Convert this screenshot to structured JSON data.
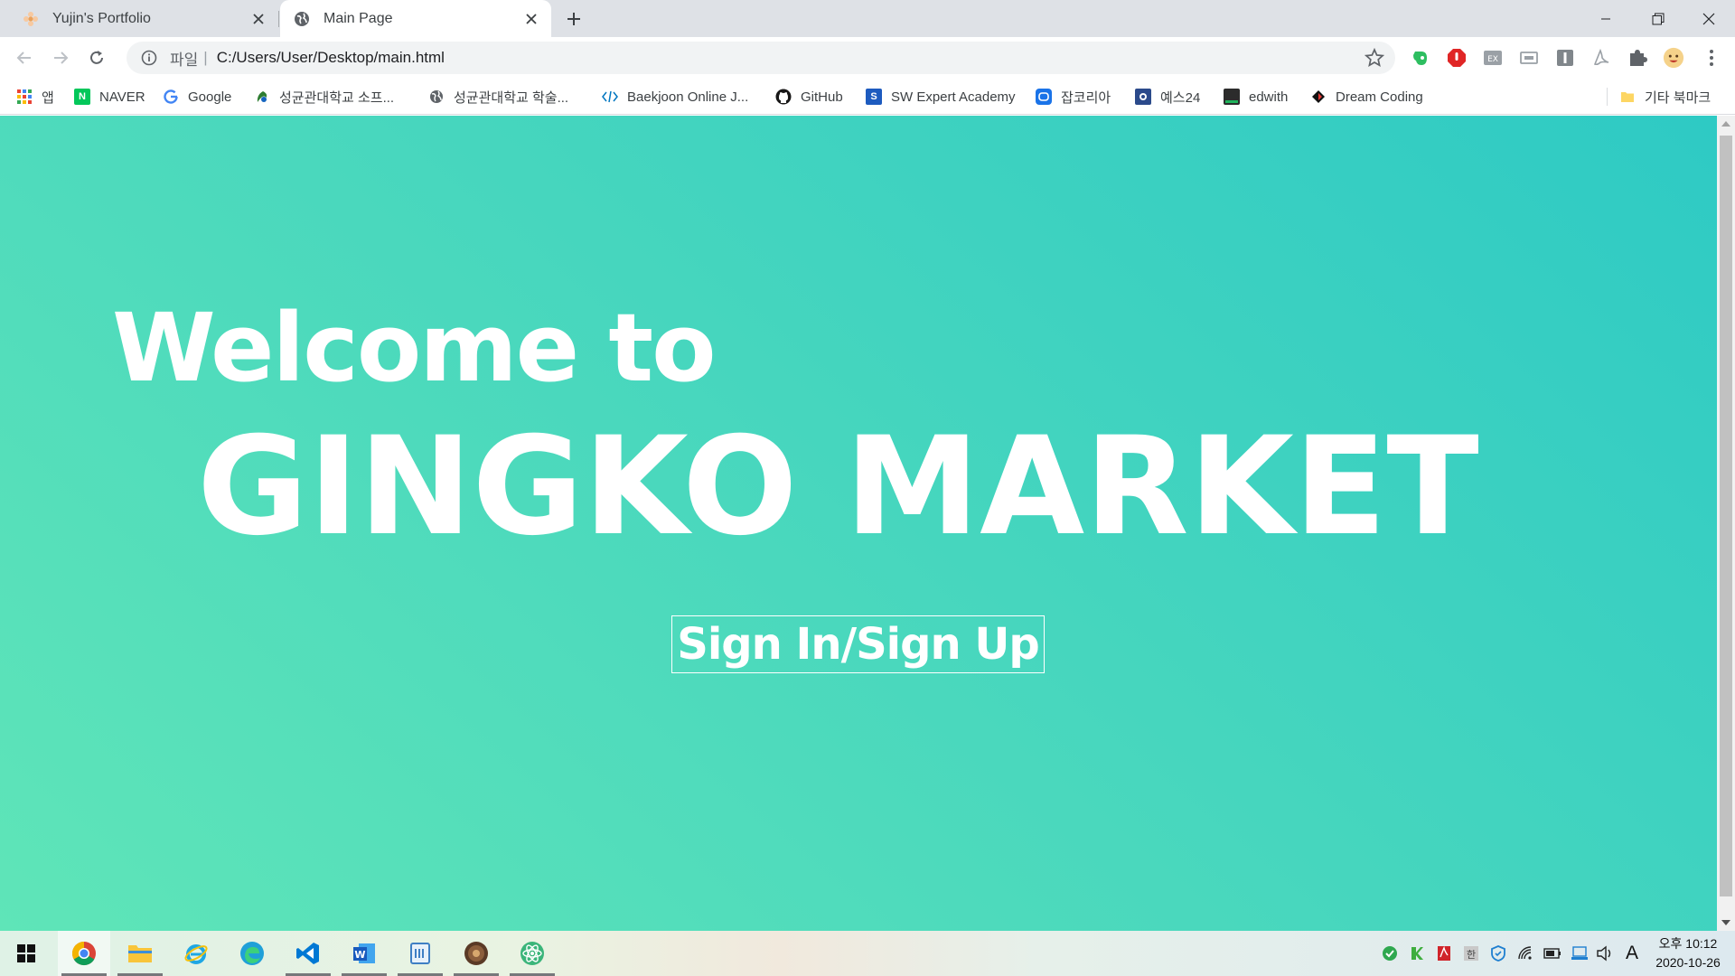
{
  "browser": {
    "tabs": [
      {
        "title": "Yujin's Portfolio",
        "active": false
      },
      {
        "title": "Main Page",
        "active": true
      }
    ],
    "address": {
      "scheme_label": "파일",
      "url": "C:/Users/User/Desktop/main.html"
    }
  },
  "bookmarks": {
    "apps_label": "앱",
    "items": [
      {
        "label": "NAVER",
        "icon": "naver-icon"
      },
      {
        "label": "Google",
        "icon": "google-icon"
      },
      {
        "label": "성균관대학교 소프...",
        "icon": "skku-icon"
      },
      {
        "label": "성균관대학교 학술...",
        "icon": "globe-icon"
      },
      {
        "label": "Baekjoon Online J...",
        "icon": "code-icon"
      },
      {
        "label": "GitHub",
        "icon": "github-icon"
      },
      {
        "label": "SW Expert Academy",
        "icon": "swea-icon"
      },
      {
        "label": "잡코리아",
        "icon": "jobkorea-icon"
      },
      {
        "label": "예스24",
        "icon": "yes24-icon"
      },
      {
        "label": "edwith",
        "icon": "edwith-icon"
      },
      {
        "label": "Dream Coding",
        "icon": "dream-coding-icon"
      }
    ],
    "other_label": "기타 북마크"
  },
  "page": {
    "welcome": "Welcome to",
    "brand": "GINGKO MARKET",
    "cta": "Sign In/Sign Up"
  },
  "taskbar": {
    "time": "오후 10:12",
    "date": "2020-10-26",
    "ime": "A"
  },
  "colors": {
    "gradient_start": "#5fe5b8",
    "gradient_end": "#2ecac4"
  }
}
